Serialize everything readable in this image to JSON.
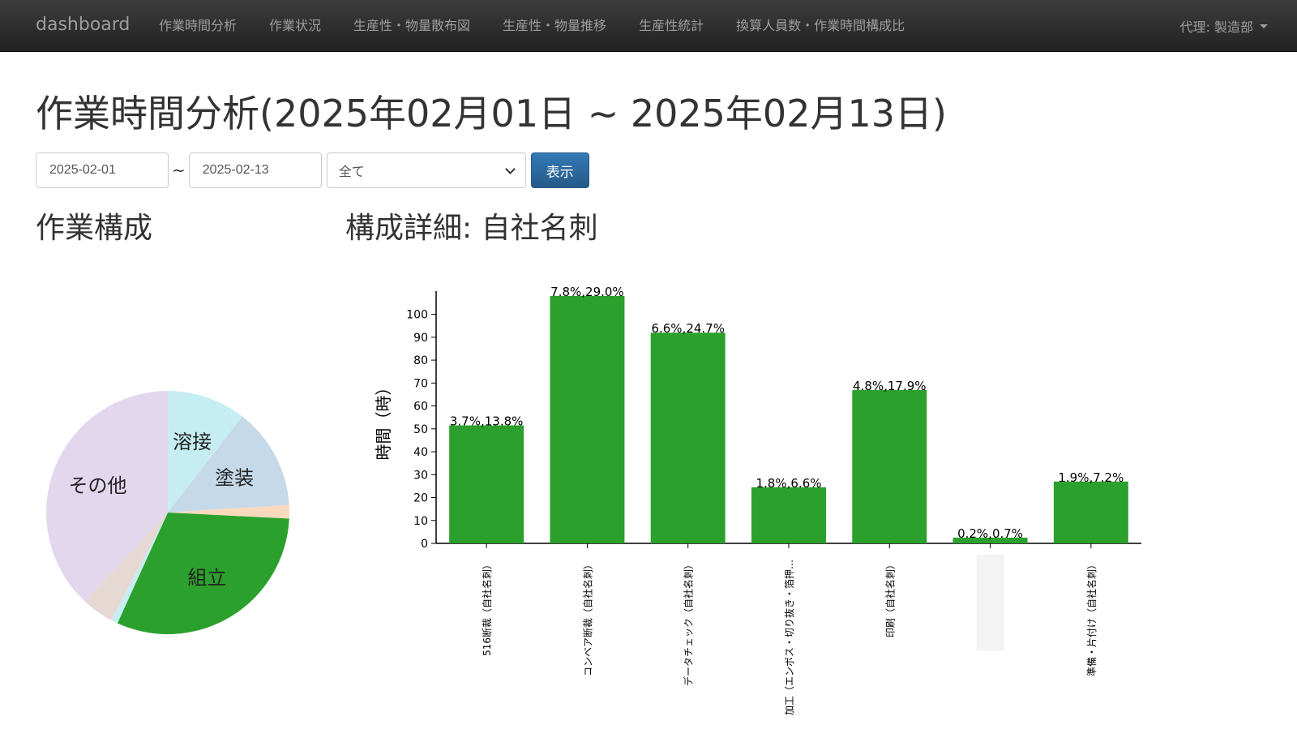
{
  "navbar": {
    "brand": "dashboard",
    "links": [
      "作業時間分析",
      "作業状況",
      "生産性・物量散布図",
      "生産性・物量推移",
      "生産性統計",
      "換算人員数・作業時間構成比"
    ],
    "user_menu": "代理: 製造部"
  },
  "page": {
    "title": "作業時間分析(2025年02月01日 ~ 2025年02月13日)"
  },
  "filter": {
    "start_date": "2025-02-01",
    "separator": "~",
    "end_date": "2025-02-13",
    "category_selected": "全て",
    "submit_label": "表示"
  },
  "sections": {
    "composition_title": "作業構成",
    "detail_title": "構成詳細: 自社名刺"
  },
  "chart_data": [
    {
      "type": "pie",
      "slices": [
        {
          "label": "溶接",
          "value": 10.5,
          "color": "#c6eef2"
        },
        {
          "label": "塗装",
          "value": 13.5,
          "color": "#c6d9e9"
        },
        {
          "label": "",
          "value": 1.8,
          "color": "#fbd9bd"
        },
        {
          "label": "組立",
          "value": 31.0,
          "color": "#2ca02c"
        },
        {
          "label": "",
          "value": 0.9,
          "color": "#c6eef2"
        },
        {
          "label": "",
          "value": 4.3,
          "color": "#e6d9d4"
        },
        {
          "label": "その他",
          "value": 38.0,
          "color": "#e3d7ee"
        }
      ]
    },
    {
      "type": "bar",
      "ylabel": "時間（時）",
      "ylim": [
        0,
        108
      ],
      "yticks": [
        0,
        10,
        20,
        30,
        40,
        50,
        60,
        70,
        80,
        90,
        100
      ],
      "color": "#2ca02c",
      "categories": [
        "516断裁（自社名刺）",
        "コンベア断裁（自社名刺）",
        "データチェック（自社名刺）",
        "加工（エンボス・切り抜き・箔押…",
        "印刷（自社名刺）",
        "",
        "準備・片付け（自社名刺）"
      ],
      "values": [
        51.5,
        108,
        92,
        24.5,
        67,
        2.5,
        27
      ],
      "data_labels": [
        "3.7%,13.8%",
        "7.8%,29.0%",
        "6.6%,24.7%",
        "1.8%,6.6%",
        "4.8%,17.9%",
        "0.2%,0.7%",
        "1.9%,7.2%"
      ]
    }
  ]
}
